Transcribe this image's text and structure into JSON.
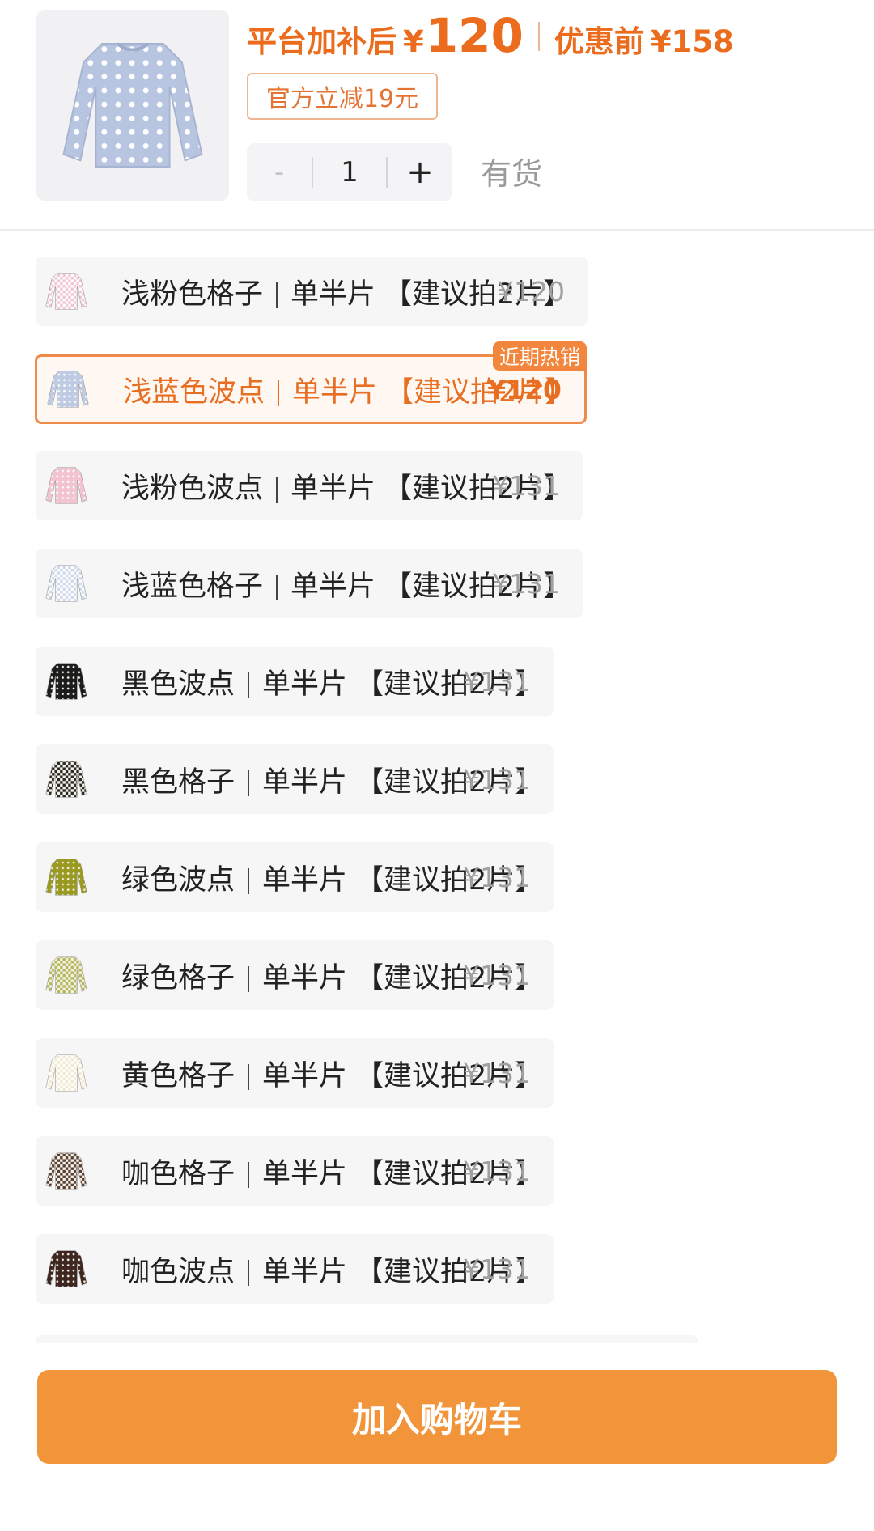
{
  "header": {
    "price_label": "平台加补后",
    "price_currency": "¥",
    "price_value": "120",
    "original_label": "优惠前",
    "original_price": "¥158",
    "discount_tag": "官方立减19元",
    "quantity_minus": "-",
    "quantity_value": "1",
    "quantity_plus": "+",
    "stock_status": "有货"
  },
  "skus": [
    {
      "color_name": "浅粉色格子",
      "spec": "单半片",
      "tip": "【建议拍2片】",
      "price": "¥120",
      "selected": false,
      "swatch": "#f0c6d2",
      "pattern": "check"
    },
    {
      "color_name": "浅蓝色波点",
      "spec": "单半片",
      "tip": "【建议拍2片】",
      "price": "¥120",
      "selected": true,
      "badge": "近期热销",
      "swatch": "#bfcbe3",
      "pattern": "dot"
    },
    {
      "color_name": "浅粉色波点",
      "spec": "单半片",
      "tip": "【建议拍2片】",
      "price": "¥131",
      "selected": false,
      "swatch": "#f2c4cf",
      "pattern": "dot"
    },
    {
      "color_name": "浅蓝色格子",
      "spec": "单半片",
      "tip": "【建议拍2片】",
      "price": "¥131",
      "selected": false,
      "swatch": "#cfd9ea",
      "pattern": "check"
    },
    {
      "color_name": "黑色波点",
      "spec": "单半片",
      "tip": "【建议拍2片】",
      "price": "¥131",
      "selected": false,
      "swatch": "#1c1c1c",
      "pattern": "dot"
    },
    {
      "color_name": "黑色格子",
      "spec": "单半片",
      "tip": "【建议拍2片】",
      "price": "¥131",
      "selected": false,
      "swatch": "#2a2a2a",
      "pattern": "check"
    },
    {
      "color_name": "绿色波点",
      "spec": "单半片",
      "tip": "【建议拍2片】",
      "price": "¥131",
      "selected": false,
      "swatch": "#9a9a22",
      "pattern": "dot"
    },
    {
      "color_name": "绿色格子",
      "spec": "单半片",
      "tip": "【建议拍2片】",
      "price": "¥131",
      "selected": false,
      "swatch": "#b5b85a",
      "pattern": "check"
    },
    {
      "color_name": "黄色格子",
      "spec": "单半片",
      "tip": "【建议拍2片】",
      "price": "¥131",
      "selected": false,
      "swatch": "#f1ead0",
      "pattern": "check"
    },
    {
      "color_name": "咖色格子",
      "spec": "单半片",
      "tip": "【建议拍2片】",
      "price": "¥131",
      "selected": false,
      "swatch": "#5a3f37",
      "pattern": "check"
    },
    {
      "color_name": "咖色波点",
      "spec": "单半片",
      "tip": "【建议拍2片】",
      "price": "¥131",
      "selected": false,
      "swatch": "#3e2721",
      "pattern": "dot"
    }
  ],
  "footer": {
    "add_to_cart": "加入购物车"
  },
  "colors": {
    "accent": "#ea6c1c",
    "button": "#f2953a",
    "chip_bg": "#f6f6f7"
  }
}
